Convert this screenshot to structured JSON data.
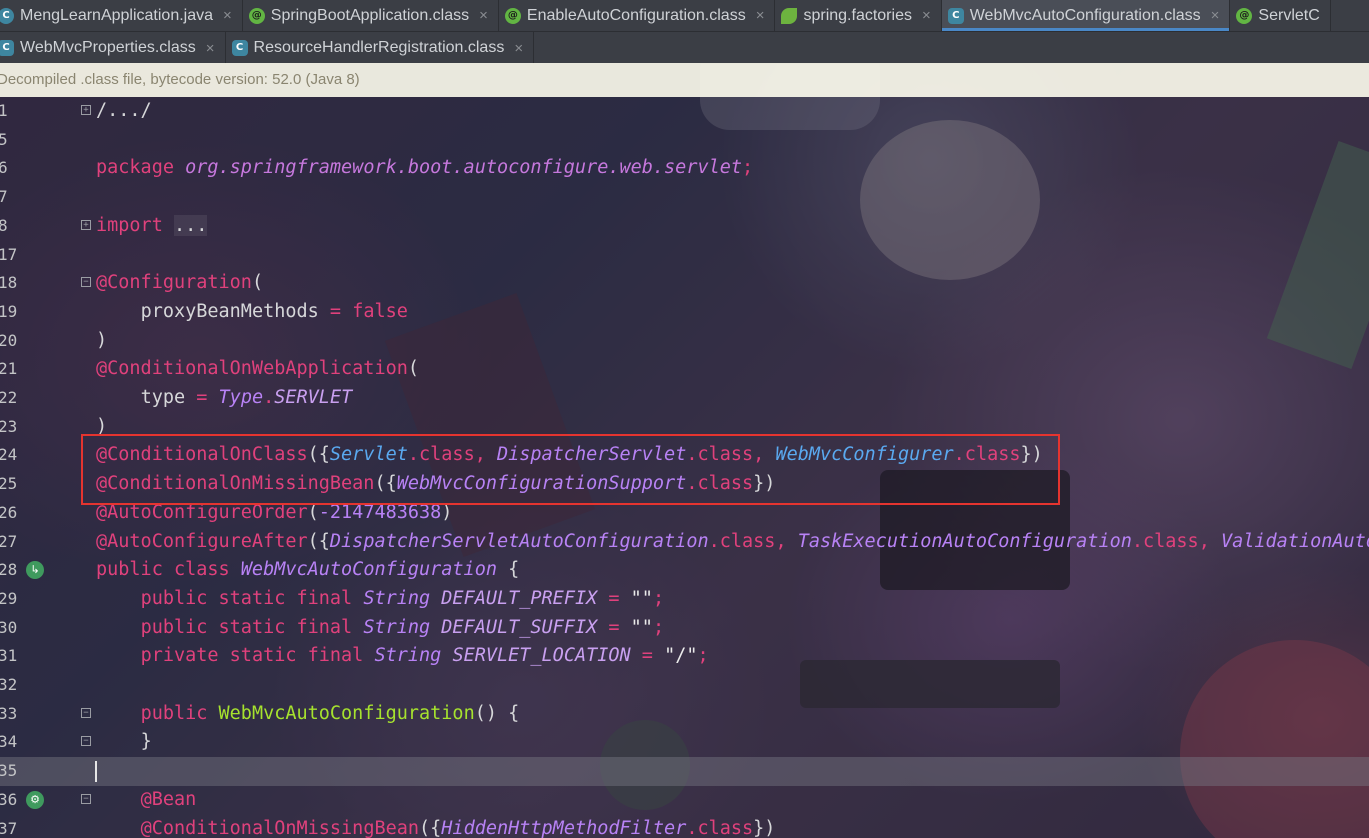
{
  "tabs_row1": [
    {
      "label": "MengLearnApplication.java",
      "icon": "java-class-icon",
      "active": false
    },
    {
      "label": "SpringBootApplication.class",
      "icon": "annotation-icon",
      "active": false
    },
    {
      "label": "EnableAutoConfiguration.class",
      "icon": "annotation-icon",
      "active": false
    },
    {
      "label": "spring.factories",
      "icon": "spring-icon",
      "active": false
    },
    {
      "label": "WebMvcAutoConfiguration.class",
      "icon": "class-file-icon",
      "active": true
    },
    {
      "label": "ServletC",
      "icon": "annotation-icon",
      "active": false
    }
  ],
  "tabs_row2": [
    {
      "label": "WebMvcProperties.class",
      "icon": "class-file-icon"
    },
    {
      "label": "ResourceHandlerRegistration.class",
      "icon": "class-file-icon"
    }
  ],
  "banner": "Decompiled .class file, bytecode version: 52.0 (Java 8)",
  "close_glyph": "×",
  "line_numbers": [
    "1",
    "5",
    "6",
    "7",
    "8",
    "17",
    "18",
    "19",
    "20",
    "21",
    "22",
    "23",
    "24",
    "25",
    "26",
    "27",
    "28",
    "29",
    "30",
    "31",
    "32",
    "33",
    "34",
    "35",
    "36",
    "37"
  ],
  "code": {
    "l1": "/.../",
    "l6_kw": "package",
    "l6_pkg": "org.springframework.boot.autoconfigure.web.servlet",
    "semicolon": ";",
    "l8_kw": "import",
    "l8_rest": "...",
    "l18": "@Configuration",
    "open_paren": "(",
    "close_paren": ")",
    "l19_name": "proxyBeanMethods",
    "eq": " = ",
    "false": "false",
    "l21": "@ConditionalOnWebApplication",
    "l22_name": "type",
    "l22_type": "Type",
    "dot": ".",
    "l22_const": "SERVLET",
    "l24_anno": "@ConditionalOnClass",
    "open_brace_paren": "({",
    "close_brace_paren": "})",
    "servlet": "Servlet",
    "dispatcher_servlet": "DispatcherServlet",
    "web_mvc_configurer": "WebMvcConfigurer",
    "dot_class": ".class",
    "comma": ", ",
    "l25_anno": "@ConditionalOnMissingBean",
    "web_mvc_configuration_support": "WebMvcConfigurationSupport",
    "l26_anno": "@AutoConfigureOrder",
    "l26_num": "-2147483638",
    "l27_anno": "@AutoConfigureAfter",
    "l27_a": "DispatcherServletAutoConfiguration",
    "l27_b": "TaskExecutionAutoConfiguration",
    "l27_c": "ValidationAutoC",
    "l28_kw": "public class",
    "l28_name": "WebMvcAutoConfiguration",
    "open_brace": " {",
    "public_static_final": "public static final",
    "private_static_final": "private static final",
    "string_type": "String",
    "l29_const": "DEFAULT_PREFIX",
    "l30_const": "DEFAULT_SUFFIX",
    "l31_const": "SERVLET_LOCATION",
    "empty_str": "\"\"",
    "slash_str": "\"/\"",
    "l33_kw": "public",
    "l33_name": "WebMvcAutoConfiguration",
    "l33_rest": "() {",
    "close_brace": "}",
    "l36": "@Bean",
    "l37_anno": "@ConditionalOnMissingBean",
    "hidden_filter": "HiddenHttpMethodFilter"
  }
}
